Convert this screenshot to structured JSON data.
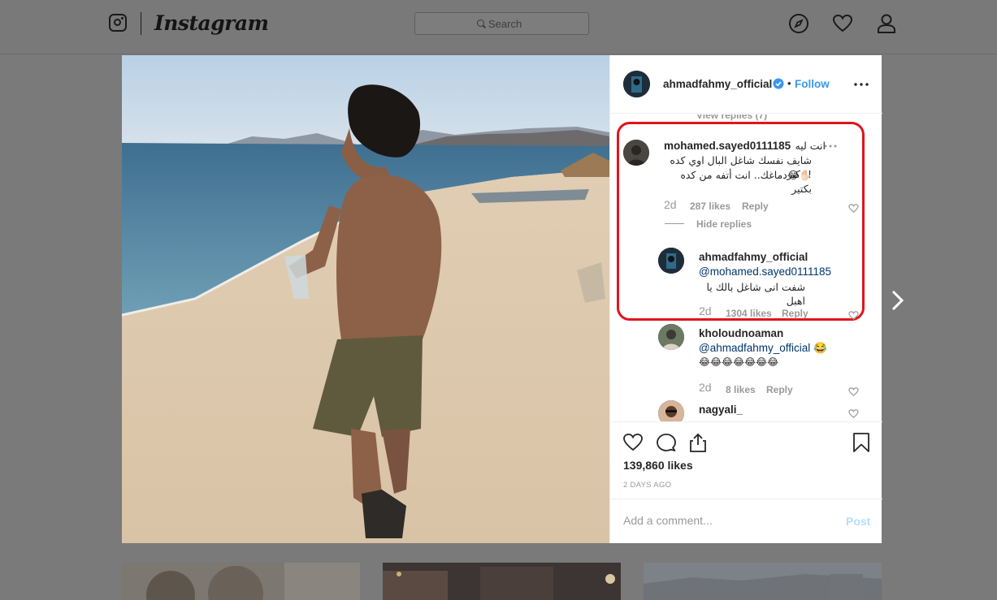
{
  "brand": {
    "wordmark": "Instagram",
    "logo_icon": "instagram-glyph-icon"
  },
  "search": {
    "placeholder": "Search",
    "icon": "search-icon"
  },
  "nav": {
    "icons": [
      "explore-compass-icon",
      "activity-heart-icon",
      "profile-person-icon"
    ]
  },
  "post": {
    "header": {
      "username": "ahmadfahmy_official",
      "verified": true,
      "separator": "•",
      "follow_label": "Follow"
    },
    "comments_panel": {
      "view_replies_label": "View replies (7)",
      "comments": [
        {
          "username": "mohamed.sayed0111185",
          "text_line1": "انت ليه",
          "text_line2": "شايف نفسك شاغل البال اوي كده !! كبر",
          "text_line3": "✋🏻😂دماغك.. انت أتفه من كده بكتير",
          "time": "2d",
          "likes": "287 likes",
          "reply_label": "Reply",
          "hide_replies_label": "Hide replies"
        },
        {
          "username": "ahmadfahmy_official",
          "mention": "@mohamed.sayed0111185",
          "text": "شفت انى شاغل بالك يا اهبل",
          "time": "2d",
          "likes": "1304 likes",
          "reply_label": "Reply"
        },
        {
          "username": "kholoudnoaman",
          "mention": "@ahmadfahmy_official",
          "emoji_suffix": "😂",
          "text_line2": "😂😂😂😂😂😂😂",
          "time": "2d",
          "likes": "8 likes",
          "reply_label": "Reply"
        },
        {
          "username": "nagyali_"
        }
      ]
    },
    "likes": "139,860 likes",
    "time_ago": "2 DAYS AGO",
    "add_comment_placeholder": "Add a comment...",
    "post_label": "Post"
  },
  "colors": {
    "follow_blue": "#3897f0",
    "highlight_red": "#e2131c",
    "overlay_gray": "#7a7a7a"
  }
}
